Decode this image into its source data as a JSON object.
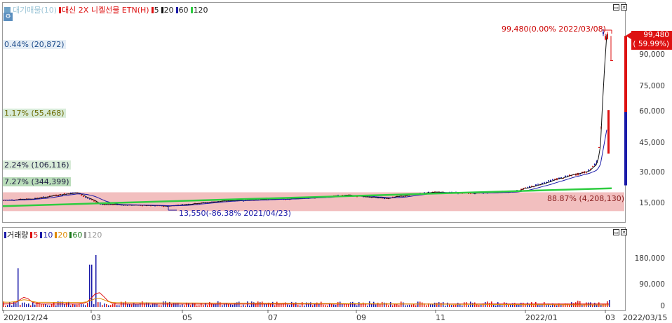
{
  "price_legend": {
    "items": [
      {
        "label": "대기매물(10)",
        "color": "#9fc7d8"
      },
      {
        "label": "대신 2X 니켈선물 ETN(H)",
        "color": "#d11"
      },
      {
        "label": "5",
        "color": "#d11"
      },
      {
        "label": "20",
        "color": "#111"
      },
      {
        "label": "60",
        "color": "#1a1aa8"
      },
      {
        "label": "120",
        "color": "#2ecc40"
      }
    ]
  },
  "volume_legend": {
    "items": [
      {
        "label": "거래량",
        "color": "#1a1aa8"
      },
      {
        "label": "5",
        "color": "#d11"
      },
      {
        "label": "10",
        "color": "#1a1aa8"
      },
      {
        "label": "20",
        "color": "#e08a00"
      },
      {
        "label": "60",
        "color": "#1a7a1a"
      },
      {
        "label": "120",
        "color": "#999"
      }
    ]
  },
  "overhang_labels": [
    {
      "text": "0.44% (20,872)",
      "color": "#1a4a8a"
    },
    {
      "text": "1.17% (55,468)",
      "color": "#6a6a00"
    },
    {
      "text": "2.24% (106,116)",
      "color": "#224"
    },
    {
      "text": "7.27% (344,399)",
      "color": "#224"
    },
    {
      "text": "88.87% (4,208,130)",
      "color": "#8b2020"
    }
  ],
  "annotations": {
    "high": "99,480(0.00% 2022/03/08)",
    "low": "13,550(-86.38% 2021/04/23)",
    "current_price": "99,480",
    "current_change": "( 59.99%)"
  },
  "price_axis": [
    "90,000",
    "75,000",
    "60,000",
    "45,000",
    "30,000",
    "15,000"
  ],
  "volume_axis": [
    "180,000",
    "90,000",
    "0"
  ],
  "x_axis": [
    "2020/12/24",
    "03",
    "05",
    "07",
    "09",
    "11",
    "2022/01",
    "03",
    "2022/03/15"
  ],
  "colors": {
    "up": "#d11",
    "down": "#1a1aa8",
    "band": "#f0b4b4"
  },
  "chart_data": {
    "type": "line",
    "title": "대신 2X 니켈선물 ETN(H)",
    "series": [
      {
        "name": "대신 2X 니켈선물 ETN(H)",
        "x": [
          "2020/12/24",
          "2021/01/15",
          "2021/02/15",
          "2021/03/05",
          "2021/04/23",
          "2021/06/01",
          "2021/07/01",
          "2021/08/01",
          "2021/09/01",
          "2021/10/01",
          "2021/11/01",
          "2021/12/01",
          "2022/01/03",
          "2022/02/01",
          "2022/02/25",
          "2022/03/04",
          "2022/03/07",
          "2022/03/08",
          "2022/03/15"
        ],
        "values": [
          16500,
          17200,
          20500,
          14500,
          13550,
          16000,
          16800,
          17500,
          19000,
          17500,
          20500,
          20000,
          21000,
          27000,
          31000,
          36000,
          55000,
          99480,
          99480
        ]
      },
      {
        "name": "120",
        "x": [
          "2020/12/24",
          "2022/03/15"
        ],
        "values": [
          13500,
          22500
        ]
      }
    ],
    "volume": {
      "axis": [
        "180,000",
        "90,000",
        "0"
      ],
      "peaks": [
        {
          "x": "2021/01/04",
          "value": 160000
        },
        {
          "x": "2021/02/26",
          "value": 175000
        },
        {
          "x": "2021/03/02",
          "value": 215000
        }
      ]
    },
    "ylim": [
      10000,
      100000
    ]
  }
}
